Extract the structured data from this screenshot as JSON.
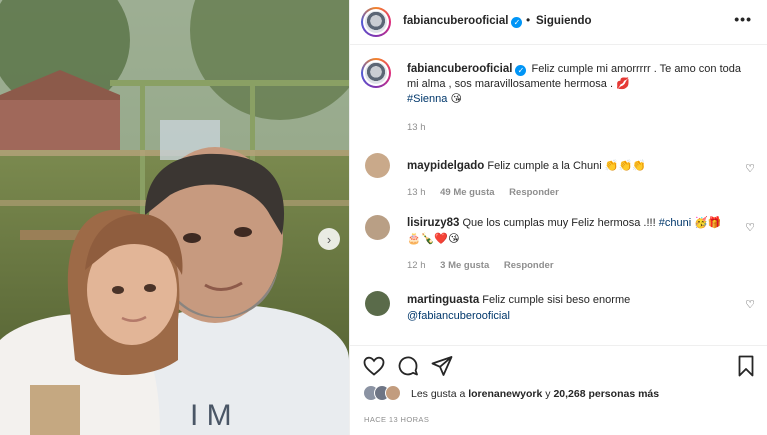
{
  "post": {
    "username": "fabiancuberooficial",
    "follow_status": "Siguiendo",
    "dot_separator": "•",
    "more_icon": "•••",
    "caption": "Feliz cumple mi amorrrrr . Te amo con toda mi alma , sos maravillosamente hermosa . 💋",
    "hashtag": "#Sienna",
    "hashtag_emoji": "😘",
    "caption_time": "13 h",
    "verified_mark": "✓",
    "photo_shirt_text": "I M",
    "next_arrow": "›"
  },
  "comments": [
    {
      "username": "maypidelgado",
      "text": "Feliz cumple a la Chuni 👏👏👏",
      "time": "13 h",
      "likes": "49 Me gusta",
      "reply": "Responder",
      "avatar_color": "#c9a98a"
    },
    {
      "username": "lisiruzy83",
      "text": "Que los cumplas muy Feliz hermosa .!!! ",
      "mention": "#chuni",
      "emojis": "🥳🎁🎂🍾❤️😘",
      "time": "12 h",
      "likes": "3 Me gusta",
      "reply": "Responder",
      "avatar_color": "#b99f85"
    },
    {
      "username": "martinguasta",
      "text": "Feliz cumple sisi beso enorme",
      "mention": "@fabiancuberooficial",
      "avatar_color": "#5a6b4a"
    }
  ],
  "actions": {
    "like_icon": "heart-icon",
    "comment_icon": "comment-icon",
    "share_icon": "share-icon",
    "save_icon": "bookmark-icon"
  },
  "likes": {
    "prefix": "Les gusta a ",
    "user": "lorenanewyork",
    "middle": " y ",
    "count": "20,268 personas más"
  },
  "posted": "HACE 13 HORAS",
  "colors": {
    "link": "#00376b",
    "verified": "#0095f6",
    "muted": "#8e8e8e"
  }
}
